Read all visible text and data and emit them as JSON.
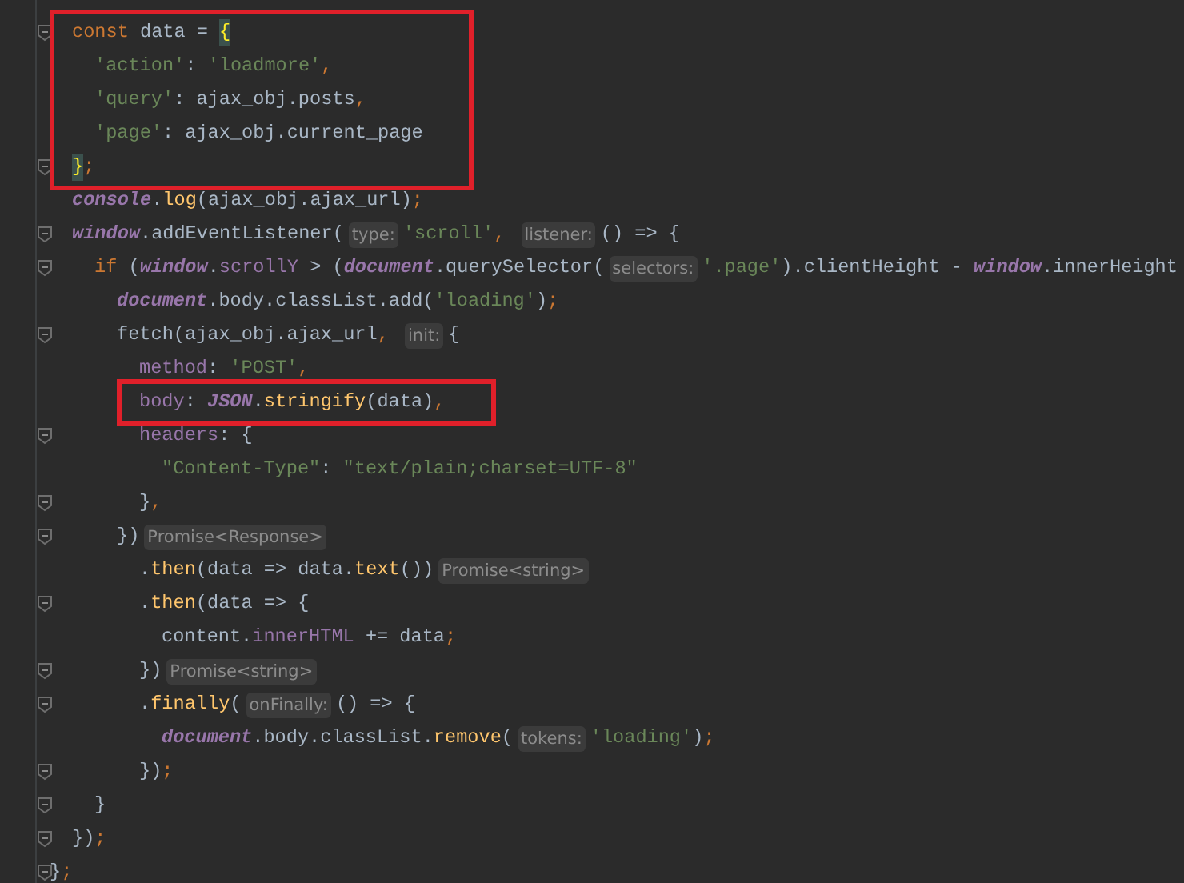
{
  "lines": [
    {
      "children": [
        {
          "fold": true,
          "boxed": true,
          "tokens": [
            {
              "kind": "kw",
              "text": "const "
            },
            {
              "kind": "plain",
              "text": "data = "
            },
            {
              "kind": "brace",
              "text": "{"
            }
          ],
          "children": [
            {
              "fold": false,
              "boxed": true,
              "tokens": [
                {
                  "kind": "str",
                  "text": "'action'"
                },
                {
                  "kind": "plain",
                  "text": ": "
                },
                {
                  "kind": "str",
                  "text": "'loadmore'"
                },
                {
                  "kind": "punct",
                  "text": ","
                }
              ]
            },
            {
              "fold": false,
              "boxed": true,
              "tokens": [
                {
                  "kind": "str",
                  "text": "'query'"
                },
                {
                  "kind": "plain",
                  "text": ": ajax_obj.posts"
                },
                {
                  "kind": "punct",
                  "text": ","
                }
              ]
            },
            {
              "fold": false,
              "boxed": true,
              "tokens": [
                {
                  "kind": "str",
                  "text": "'page'"
                },
                {
                  "kind": "plain",
                  "text": ": ajax_obj.current_page"
                }
              ]
            }
          ]
        },
        {
          "fold": true,
          "boxed": true,
          "tokens": [
            {
              "kind": "brace",
              "text": "}"
            },
            {
              "kind": "punct",
              "text": ";"
            }
          ]
        },
        {
          "fold": false,
          "boxed": false,
          "tokens": [
            {
              "kind": "glob",
              "text": "console"
            },
            {
              "kind": "plain",
              "text": "."
            },
            {
              "kind": "fn",
              "text": "log"
            },
            {
              "kind": "plain",
              "text": "(ajax_obj.ajax_url)"
            },
            {
              "kind": "punct",
              "text": ";"
            }
          ]
        },
        {
          "fold": true,
          "boxed": false,
          "tokens": [
            {
              "kind": "glob",
              "text": "window"
            },
            {
              "kind": "plain",
              "text": ".addEventListener("
            },
            {
              "kind": "hint",
              "text": "type:"
            },
            {
              "kind": "str",
              "text": "'scroll'"
            },
            {
              "kind": "punct",
              "text": ", "
            },
            {
              "kind": "hint",
              "text": "listener:"
            },
            {
              "kind": "plain",
              "text": "() => {"
            }
          ],
          "children": [
            {
              "fold": true,
              "boxed": false,
              "tokens": [
                {
                  "kind": "kw",
                  "text": "if "
                },
                {
                  "kind": "plain",
                  "text": "("
                },
                {
                  "kind": "glob",
                  "text": "window"
                },
                {
                  "kind": "plain",
                  "text": "."
                },
                {
                  "kind": "prop",
                  "text": "scrollY"
                },
                {
                  "kind": "plain",
                  "text": " > ("
                },
                {
                  "kind": "glob",
                  "text": "document"
                },
                {
                  "kind": "plain",
                  "text": ".querySelector("
                },
                {
                  "kind": "hint",
                  "text": "selectors:"
                },
                {
                  "kind": "str",
                  "text": "'.page'"
                },
                {
                  "kind": "plain",
                  "text": ").clientHeight - "
                },
                {
                  "kind": "glob",
                  "text": "window"
                },
                {
                  "kind": "plain",
                  "text": ".innerHeight"
                }
              ],
              "children": [
                {
                  "fold": false,
                  "boxed": false,
                  "tokens": [
                    {
                      "kind": "glob",
                      "text": "document"
                    },
                    {
                      "kind": "plain",
                      "text": ".body.classList.add("
                    },
                    {
                      "kind": "str",
                      "text": "'loading'"
                    },
                    {
                      "kind": "plain",
                      "text": ")"
                    },
                    {
                      "kind": "punct",
                      "text": ";"
                    }
                  ]
                },
                {
                  "fold": true,
                  "boxed": false,
                  "tokens": [
                    {
                      "kind": "plain",
                      "text": "fetch(ajax_obj.ajax_url"
                    },
                    {
                      "kind": "punct",
                      "text": ", "
                    },
                    {
                      "kind": "hint",
                      "text": "init:"
                    },
                    {
                      "kind": "plain",
                      "text": "{"
                    }
                  ],
                  "children": [
                    {
                      "fold": false,
                      "boxed": false,
                      "tokens": [
                        {
                          "kind": "prop",
                          "text": "method"
                        },
                        {
                          "kind": "plain",
                          "text": ": "
                        },
                        {
                          "kind": "str",
                          "text": "'POST'"
                        },
                        {
                          "kind": "punct",
                          "text": ","
                        }
                      ]
                    },
                    {
                      "fold": false,
                      "boxed": true,
                      "tokens": [
                        {
                          "kind": "prop",
                          "text": "body"
                        },
                        {
                          "kind": "plain",
                          "text": ": "
                        },
                        {
                          "kind": "glob",
                          "text": "JSON"
                        },
                        {
                          "kind": "plain",
                          "text": "."
                        },
                        {
                          "kind": "fn",
                          "text": "stringify"
                        },
                        {
                          "kind": "plain",
                          "text": "(data)"
                        },
                        {
                          "kind": "punct",
                          "text": ","
                        }
                      ]
                    },
                    {
                      "fold": true,
                      "boxed": false,
                      "tokens": [
                        {
                          "kind": "prop",
                          "text": "headers"
                        },
                        {
                          "kind": "plain",
                          "text": ": {"
                        }
                      ],
                      "children": [
                        {
                          "fold": false,
                          "boxed": false,
                          "tokens": [
                            {
                              "kind": "str",
                              "text": "\"Content-Type\""
                            },
                            {
                              "kind": "plain",
                              "text": ": "
                            },
                            {
                              "kind": "str",
                              "text": "\"text/plain;charset=UTF-8\""
                            }
                          ]
                        }
                      ]
                    },
                    {
                      "fold": true,
                      "boxed": false,
                      "tokens": [
                        {
                          "kind": "plain",
                          "text": "}"
                        },
                        {
                          "kind": "punct",
                          "text": ","
                        }
                      ]
                    }
                  ]
                },
                {
                  "fold": true,
                  "boxed": false,
                  "tokens": [
                    {
                      "kind": "plain",
                      "text": "})"
                    },
                    {
                      "kind": "hint",
                      "text": "Promise<Response>"
                    }
                  ],
                  "children": [
                    {
                      "fold": false,
                      "boxed": false,
                      "tokens": [
                        {
                          "kind": "plain",
                          "text": "."
                        },
                        {
                          "kind": "fn",
                          "text": "then"
                        },
                        {
                          "kind": "plain",
                          "text": "(data => data."
                        },
                        {
                          "kind": "fn",
                          "text": "text"
                        },
                        {
                          "kind": "plain",
                          "text": "())"
                        },
                        {
                          "kind": "hint",
                          "text": "Promise<string>"
                        }
                      ]
                    },
                    {
                      "fold": true,
                      "boxed": false,
                      "tokens": [
                        {
                          "kind": "plain",
                          "text": "."
                        },
                        {
                          "kind": "fn",
                          "text": "then"
                        },
                        {
                          "kind": "plain",
                          "text": "(data => {"
                        }
                      ],
                      "children": [
                        {
                          "fold": false,
                          "boxed": false,
                          "tokens": [
                            {
                              "kind": "plain",
                              "text": "content."
                            },
                            {
                              "kind": "prop",
                              "text": "innerHTML"
                            },
                            {
                              "kind": "plain",
                              "text": " += data"
                            },
                            {
                              "kind": "punct",
                              "text": ";"
                            }
                          ]
                        }
                      ]
                    },
                    {
                      "fold": true,
                      "boxed": false,
                      "tokens": [
                        {
                          "kind": "plain",
                          "text": "})"
                        },
                        {
                          "kind": "hint",
                          "text": "Promise<string>"
                        }
                      ]
                    },
                    {
                      "fold": true,
                      "boxed": false,
                      "tokens": [
                        {
                          "kind": "plain",
                          "text": "."
                        },
                        {
                          "kind": "fn",
                          "text": "finally"
                        },
                        {
                          "kind": "plain",
                          "text": "("
                        },
                        {
                          "kind": "hint",
                          "text": "onFinally:"
                        },
                        {
                          "kind": "plain",
                          "text": "() => {"
                        }
                      ],
                      "children": [
                        {
                          "fold": false,
                          "boxed": false,
                          "tokens": [
                            {
                              "kind": "glob",
                              "text": "document"
                            },
                            {
                              "kind": "plain",
                              "text": ".body.classList."
                            },
                            {
                              "kind": "fn",
                              "text": "remove"
                            },
                            {
                              "kind": "plain",
                              "text": "("
                            },
                            {
                              "kind": "hint",
                              "text": "tokens:"
                            },
                            {
                              "kind": "str",
                              "text": "'loading'"
                            },
                            {
                              "kind": "plain",
                              "text": ")"
                            },
                            {
                              "kind": "punct",
                              "text": ";"
                            }
                          ]
                        }
                      ]
                    },
                    {
                      "fold": true,
                      "boxed": false,
                      "tokens": [
                        {
                          "kind": "plain",
                          "text": "})"
                        },
                        {
                          "kind": "punct",
                          "text": ";"
                        }
                      ]
                    }
                  ]
                }
              ]
            },
            {
              "fold": true,
              "boxed": false,
              "tokens": [
                {
                  "kind": "plain",
                  "text": "}"
                }
              ]
            }
          ]
        },
        {
          "fold": true,
          "boxed": false,
          "tokens": [
            {
              "kind": "plain",
              "text": "})"
            },
            {
              "kind": "punct",
              "text": ";"
            }
          ]
        }
      ]
    },
    {
      "fold": true,
      "boxed": false,
      "tokens": [
        {
          "kind": "plain",
          "text": "}"
        },
        {
          "kind": "punct",
          "text": ";"
        }
      ]
    }
  ]
}
